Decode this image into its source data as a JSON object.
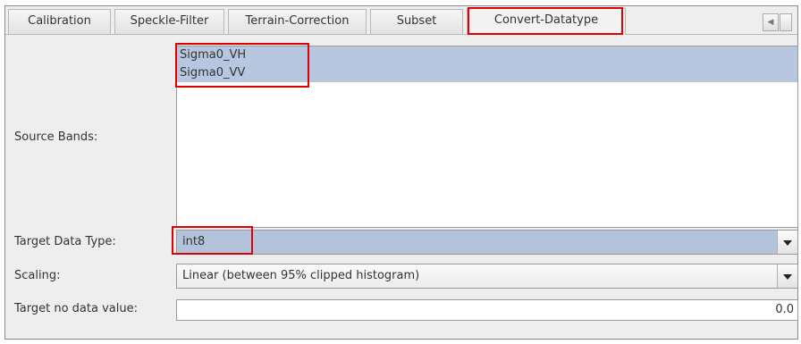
{
  "tabs": [
    {
      "label": "Calibration"
    },
    {
      "label": "Speckle-Filter"
    },
    {
      "label": "Terrain-Correction"
    },
    {
      "label": "Subset"
    },
    {
      "label": "Convert-Datatype"
    }
  ],
  "tab_scroll_arrow": "◀",
  "source_bands": {
    "label": "Source Bands:",
    "items": [
      "Sigma0_VH",
      "Sigma0_VV"
    ]
  },
  "target_data_type": {
    "label": "Target Data Type:",
    "value": "int8"
  },
  "scaling": {
    "label": "Scaling:",
    "value": "Linear (between 95% clipped histogram)"
  },
  "target_no_data": {
    "label": "Target no data value:",
    "value": "0.0"
  },
  "colors": {
    "highlight": "#e00000",
    "selection": "#b7c7df",
    "combo_bg": "#b3c3db"
  }
}
